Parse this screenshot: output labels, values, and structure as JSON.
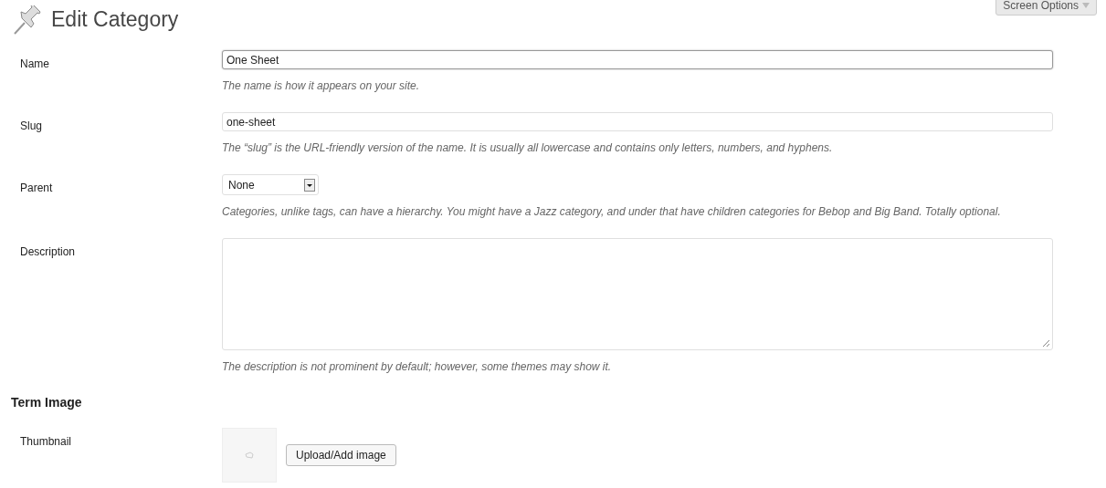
{
  "header": {
    "title": "Edit Category",
    "screen_options": "Screen Options"
  },
  "fields": [
    {
      "kind": "text",
      "label": "Name",
      "value": "One Sheet",
      "focused": true,
      "hint": "The name is how it appears on your site."
    },
    {
      "kind": "text",
      "label": "Slug",
      "value": "one-sheet",
      "focused": false,
      "hint": "The “slug” is the URL-friendly version of the name. It is usually all lowercase and contains only letters, numbers, and hyphens."
    },
    {
      "kind": "select",
      "label": "Parent",
      "value": "None",
      "hint": "Categories, unlike tags, can have a hierarchy. You might have a Jazz category, and under that have children categories for Bebop and Big Band. Totally optional."
    },
    {
      "kind": "textarea",
      "label": "Description",
      "hint": "The description is not prominent by default; however, some themes may show it."
    }
  ],
  "term_image": {
    "heading": "Term Image",
    "label": "Thumbnail",
    "button": "Upload/Add image"
  }
}
